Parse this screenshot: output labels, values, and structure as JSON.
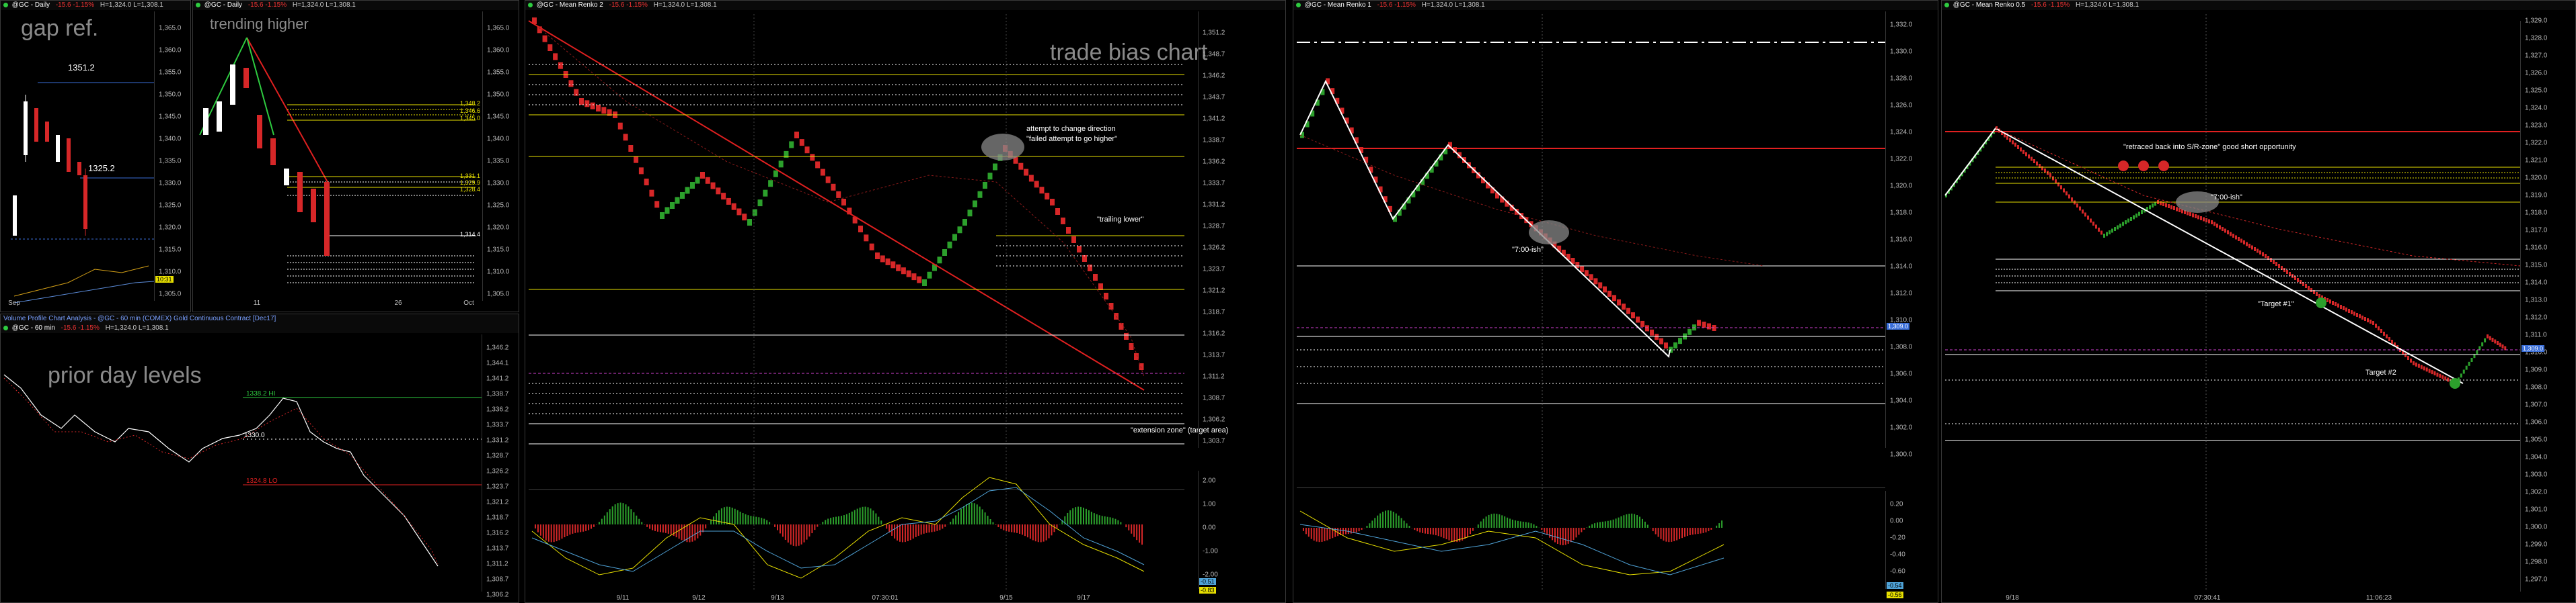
{
  "panels": {
    "daily": {
      "symbol": "@GC - Daily",
      "change": "-15.6 -1.15%",
      "range": "H=1,324.0 L=1,308.1",
      "title": "gap ref.",
      "label_a": "1351.2",
      "label_b": "1325.2",
      "last_tag": "10:31",
      "x_labels": [
        "Sep"
      ],
      "y_labels": [
        "1,365.0",
        "1,360.0",
        "1,355.0",
        "1,350.0",
        "1,345.0",
        "1,340.0",
        "1,335.0",
        "1,330.0",
        "1,325.0",
        "1,320.0",
        "1,315.0",
        "1,310.0",
        "1,305.0"
      ]
    },
    "trending": {
      "symbol": "@GC - Daily",
      "change": "-15.6 -1.15%",
      "range": "H=1,324.0 L=1,308.1",
      "title": "trending higher",
      "x_labels": [
        "11",
        "26",
        "Oct"
      ],
      "y_labels": [
        "1,365.0",
        "1,360.0",
        "1,355.0",
        "1,350.0",
        "1,345.0",
        "1,340.0",
        "1,335.0",
        "1,330.0",
        "1,325.0",
        "1,320.0",
        "1,315.0",
        "1,310.0",
        "1,305.0"
      ],
      "levels": [
        "1,348.2",
        "1,346.6",
        "1,345.0",
        "1,331.1",
        "1,329.9",
        "1,328.4",
        "1,314.4"
      ]
    },
    "sixty": {
      "symbol": "@GC - 60 min",
      "change": "-15.6 -1.15%",
      "range": "H=1,324.0 L=1,308.1",
      "header": "Volume Profile Chart Analysis - @GC - 60 min (COMEX) Gold Continuous Contract [Dec17]",
      "title": "prior day levels",
      "label_high": "1338.2 HI",
      "label_close": "1330.0",
      "label_low": "1324.8 LO",
      "y_labels": [
        "1,346.2",
        "1,344.1",
        "1,341.2",
        "1,338.7",
        "1,336.2",
        "1,333.7",
        "1,331.2",
        "1,328.7",
        "1,326.2",
        "1,323.7",
        "1,321.2",
        "1,318.7",
        "1,316.2",
        "1,313.7",
        "1,311.2",
        "1,308.7",
        "1,306.2"
      ]
    },
    "bias": {
      "symbol": "@GC - Mean Renko 2",
      "change": "-15.6 -1.15%",
      "range": "H=1,324.0 L=1,308.1",
      "title": "trade bias chart",
      "annotation_1": "attempt to change direction",
      "annotation_2": "\"failed attempt to go higher\"",
      "annotation_3": "\"trailing lower\"",
      "annotation_4": "\"extension zone\" (target area)",
      "x_labels": [
        "9/11",
        "9/12",
        "9/13",
        "07:30:01",
        "9/15",
        "9/17"
      ],
      "y_labels": [
        "1,351.2",
        "1,348.7",
        "1,346.2",
        "1,343.7",
        "1,341.2",
        "1,338.7",
        "1,336.2",
        "1,333.7",
        "1,331.2",
        "1,328.7",
        "1,326.2",
        "1,323.7",
        "1,321.2",
        "1,318.7",
        "1,316.2",
        "1,313.7",
        "1,311.2",
        "1,308.7",
        "1,306.2",
        "1,303.7"
      ],
      "osc_labels": [
        "2.00",
        "1.00",
        "0.00",
        "-1.00",
        "-2.00"
      ],
      "osc_tags": [
        "-0.51",
        "-0.83"
      ]
    },
    "mr1": {
      "symbol": "@GC - Mean Renko 1",
      "change": "-15.6 -1.15%",
      "range": "H=1,324.0 L=1,308.1",
      "annotation": "\"7:00-ish\"",
      "y_labels": [
        "1,332.0",
        "1,330.0",
        "1,328.0",
        "1,326.0",
        "1,324.0",
        "1,322.0",
        "1,320.0",
        "1,318.0",
        "1,316.0",
        "1,314.0",
        "1,312.0",
        "1,310.0",
        "1,308.0",
        "1,306.0",
        "1,304.0",
        "1,302.0",
        "1,300.0"
      ],
      "osc_labels": [
        "0.20",
        "0.00",
        "-0.20",
        "-0.40",
        "-0.60"
      ],
      "osc_tags": [
        "-0.56",
        "-0.54"
      ],
      "last_price": "1,309.0"
    },
    "mr05": {
      "symbol": "@GC - Mean Renko 0.5",
      "change": "-15.6 -1.15%",
      "range": "H=1,324.0 L=1,308.1",
      "annotation_1": "\"retraced back into S/R-zone\" good short opportunity",
      "annotation_2": "\"7:00-ish\"",
      "annotation_3": "\"Target #1\"",
      "annotation_4": "Target #2",
      "x_labels": [
        "9/18",
        "07:30:41",
        "11:06:23"
      ],
      "y_labels": [
        "1,329.0",
        "1,328.0",
        "1,327.0",
        "1,326.0",
        "1,325.0",
        "1,324.0",
        "1,323.0",
        "1,322.0",
        "1,321.0",
        "1,320.0",
        "1,319.0",
        "1,318.0",
        "1,317.0",
        "1,316.0",
        "1,315.0",
        "1,314.0",
        "1,313.0",
        "1,312.0",
        "1,311.0",
        "1,310.0",
        "1,309.0",
        "1,308.0",
        "1,307.0",
        "1,306.0",
        "1,305.0",
        "1,304.0",
        "1,303.0",
        "1,302.0",
        "1,301.0",
        "1,300.0",
        "1,299.0",
        "1,298.0",
        "1,297.0"
      ],
      "last_price": "1,309.0"
    }
  },
  "colors": {
    "up": "#2ca02c",
    "down": "#d62728",
    "resistance": "#e02020",
    "support_yellow": "#e8e000",
    "ma": "#8b1a1a",
    "pink": "#d040d0"
  }
}
